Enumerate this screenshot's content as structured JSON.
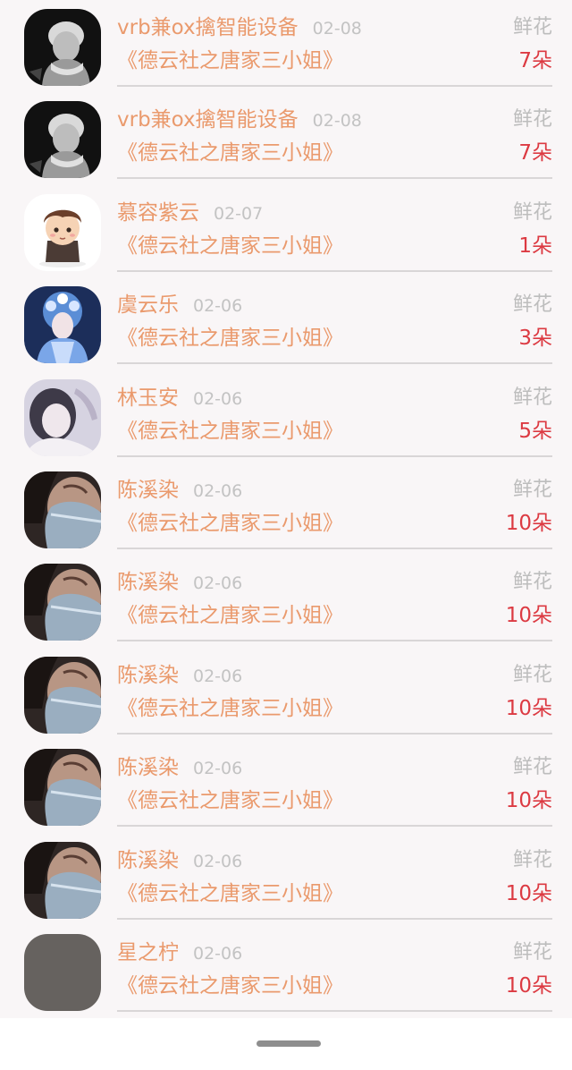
{
  "gift_records": [
    {
      "name": "vrb兼ox擒智能设备",
      "date": "02-08",
      "gift_label": "鲜花",
      "show": "《德云社之唐家三小姐》",
      "count": "7朵",
      "avatar": "sketch-portrait"
    },
    {
      "name": "vrb兼ox擒智能设备",
      "date": "02-08",
      "gift_label": "鲜花",
      "show": "《德云社之唐家三小姐》",
      "count": "7朵",
      "avatar": "sketch-portrait"
    },
    {
      "name": "慕容紫云",
      "date": "02-07",
      "gift_label": "鲜花",
      "show": "《德云社之唐家三小姐》",
      "count": "1朵",
      "avatar": "cartoon-boy"
    },
    {
      "name": "虞云乐",
      "date": "02-06",
      "gift_label": "鲜花",
      "show": "《德云社之唐家三小姐》",
      "count": "3朵",
      "avatar": "opera-costume"
    },
    {
      "name": "林玉安",
      "date": "02-06",
      "gift_label": "鲜花",
      "show": "《德云社之唐家三小姐》",
      "count": "5朵",
      "avatar": "soft-portrait"
    },
    {
      "name": "陈溪染",
      "date": "02-06",
      "gift_label": "鲜花",
      "show": "《德云社之唐家三小姐》",
      "count": "10朵",
      "avatar": "masked-selfie"
    },
    {
      "name": "陈溪染",
      "date": "02-06",
      "gift_label": "鲜花",
      "show": "《德云社之唐家三小姐》",
      "count": "10朵",
      "avatar": "masked-selfie"
    },
    {
      "name": "陈溪染",
      "date": "02-06",
      "gift_label": "鲜花",
      "show": "《德云社之唐家三小姐》",
      "count": "10朵",
      "avatar": "masked-selfie"
    },
    {
      "name": "陈溪染",
      "date": "02-06",
      "gift_label": "鲜花",
      "show": "《德云社之唐家三小姐》",
      "count": "10朵",
      "avatar": "masked-selfie"
    },
    {
      "name": "陈溪染",
      "date": "02-06",
      "gift_label": "鲜花",
      "show": "《德云社之唐家三小姐》",
      "count": "10朵",
      "avatar": "masked-selfie"
    },
    {
      "name": "星之柠",
      "date": "02-06",
      "gift_label": "鲜花",
      "show": "《德云社之唐家三小姐》",
      "count": "10朵",
      "avatar": "placeholder"
    }
  ],
  "colors": {
    "name": "#ea9a6d",
    "date": "#c3c3c3",
    "gift_label": "#bdbdbd",
    "count": "#dc3a42",
    "divider": "#d9d6d7",
    "list_background": "#f9f6f7"
  }
}
